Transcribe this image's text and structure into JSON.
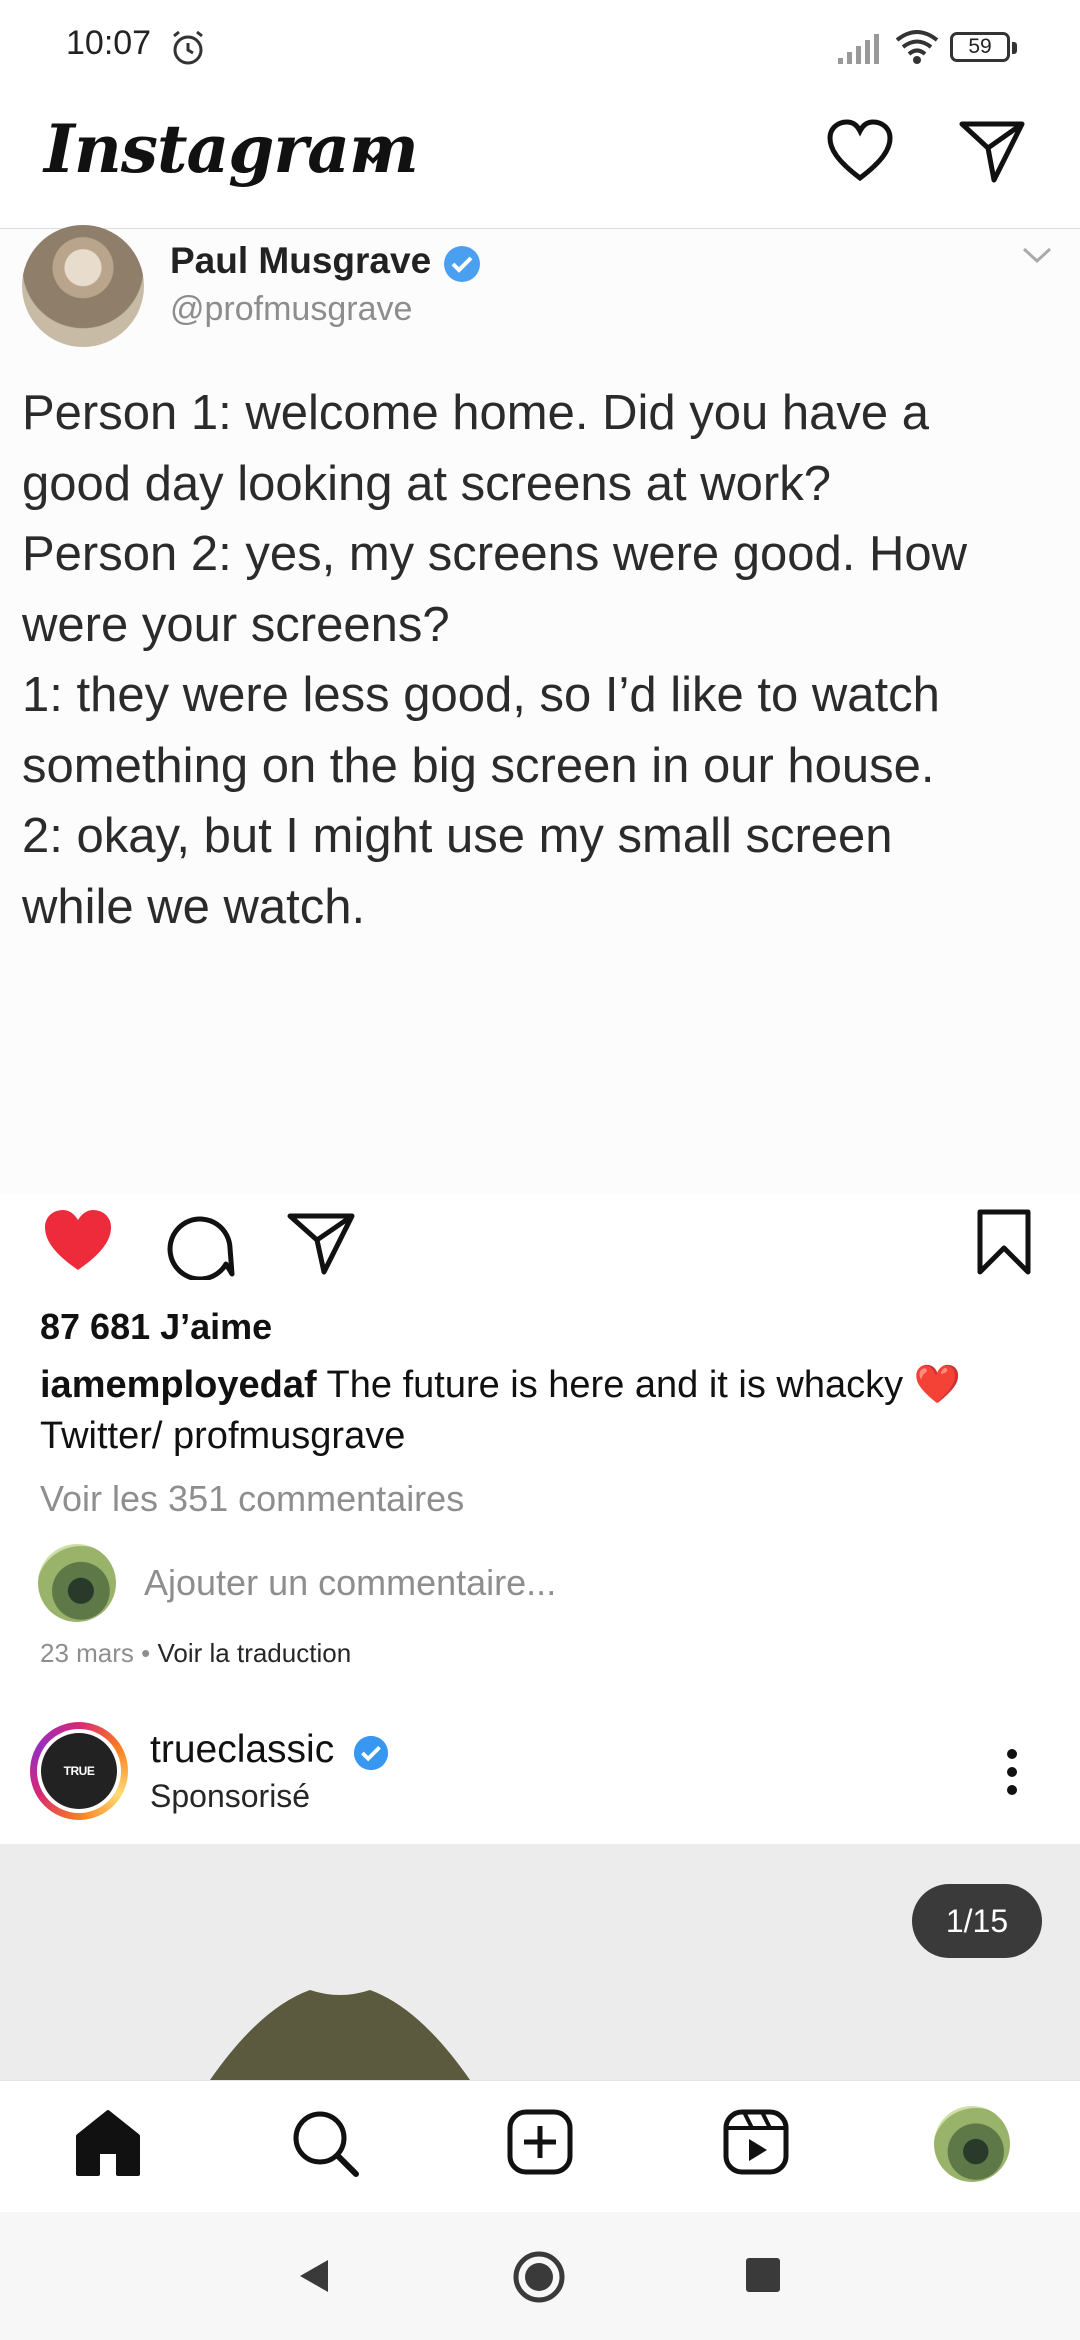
{
  "status_bar": {
    "time": "10:07",
    "battery": "59"
  },
  "header": {
    "logo": "Instagram"
  },
  "tweet": {
    "name": "Paul Musgrave",
    "handle": "@profmusgrave",
    "lines": [
      "Person 1: welcome home. Did you have a",
      "good day looking at screens at work?",
      "Person 2: yes, my screens were good. How",
      "were your screens?",
      "1: they were less good, so I’d like to watch",
      "something on the big screen in our house.",
      "2: okay, but I might use my small screen",
      "while we watch."
    ]
  },
  "post": {
    "likes": "87 681 J’aime",
    "caption_user": "iamemployedaf",
    "caption_text": " The future is here and it is whacky ",
    "caption_emoji": "❤️",
    "caption_line2": "Twitter/ profmusgrave",
    "view_comments": "Voir les 351 commentaires",
    "add_comment_placeholder": "Ajouter un commentaire...",
    "date": "23 mars",
    "separator": " • ",
    "translate": "Voir la traduction"
  },
  "sponsored": {
    "name": "trueclassic",
    "label": "Sponsorisé",
    "avatar_text": "TRUE CLASSIC",
    "counter": "1/15"
  },
  "colors": {
    "like_red": "#ed4956",
    "verified_blue": "#3897f0"
  }
}
